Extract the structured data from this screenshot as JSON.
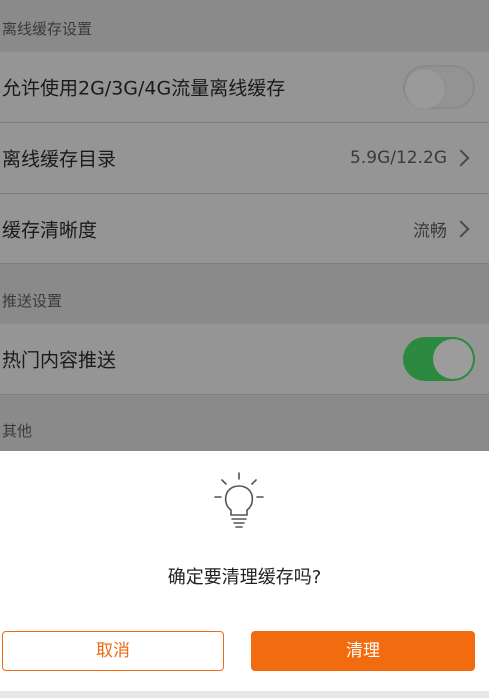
{
  "sections": {
    "offline_cache": "离线缓存设置",
    "push": "推送设置",
    "other": "其他"
  },
  "rows": {
    "allow_mobile_cache": {
      "label": "允许使用2G/3G/4G流量离线缓存",
      "toggle": "off"
    },
    "cache_directory": {
      "label": "离线缓存目录",
      "value": "5.9G/12.2G"
    },
    "cache_quality": {
      "label": "缓存清晰度",
      "value": "流畅"
    },
    "hot_push": {
      "label": "热门内容推送",
      "toggle": "on"
    }
  },
  "dialog": {
    "icon": "lightbulb-icon",
    "message": "确定要清理缓存吗?",
    "cancel_label": "取消",
    "confirm_label": "清理"
  },
  "colors": {
    "accent": "#f26b0f",
    "toggle_on": "#2b8a3f"
  }
}
